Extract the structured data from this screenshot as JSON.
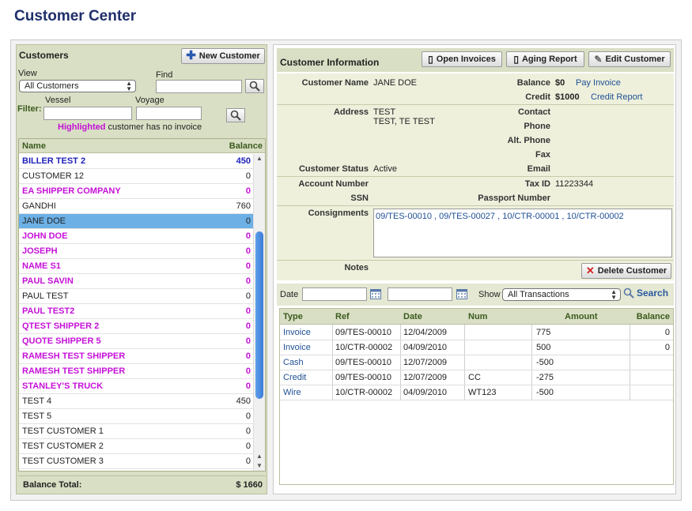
{
  "page": {
    "title": "Customer Center"
  },
  "customers_panel": {
    "title": "Customers",
    "new_button": "New Customer",
    "view_label": "View",
    "view_selected": "All Customers",
    "find_label": "Find",
    "filter_label": "Filter:",
    "vessel_label": "Vessel",
    "voyage_label": "Voyage",
    "legend_highlight": "Highlighted",
    "legend_rest": " customer has no invoice",
    "col_name": "Name",
    "col_balance": "Balance",
    "rows": [
      {
        "name": "BILLER TEST 2",
        "balance": "450",
        "style": "blue"
      },
      {
        "name": "CUSTOMER 12",
        "balance": "0",
        "style": ""
      },
      {
        "name": "EA SHIPPER COMPANY",
        "balance": "0",
        "style": "mag"
      },
      {
        "name": "GANDHI",
        "balance": "760",
        "style": ""
      },
      {
        "name": "JANE DOE",
        "balance": "0",
        "style": "sel"
      },
      {
        "name": "JOHN DOE",
        "balance": "0",
        "style": "mag"
      },
      {
        "name": "JOSEPH",
        "balance": "0",
        "style": "mag"
      },
      {
        "name": "NAME S1",
        "balance": "0",
        "style": "mag"
      },
      {
        "name": "PAUL SAVIN",
        "balance": "0",
        "style": "mag"
      },
      {
        "name": "PAUL TEST",
        "balance": "0",
        "style": ""
      },
      {
        "name": "PAUL TEST2",
        "balance": "0",
        "style": "mag"
      },
      {
        "name": "QTEST SHIPPER 2",
        "balance": "0",
        "style": "mag"
      },
      {
        "name": "QUOTE SHIPPER 5",
        "balance": "0",
        "style": "mag"
      },
      {
        "name": "RAMESH TEST SHIPPER",
        "balance": "0",
        "style": "mag"
      },
      {
        "name": "RAMESH TEST SHIPPER",
        "balance": "0",
        "style": "mag"
      },
      {
        "name": "STANLEY'S TRUCK",
        "balance": "0",
        "style": "mag"
      },
      {
        "name": "TEST 4",
        "balance": "450",
        "style": ""
      },
      {
        "name": "TEST 5",
        "balance": "0",
        "style": ""
      },
      {
        "name": "TEST CUSTOMER 1",
        "balance": "0",
        "style": ""
      },
      {
        "name": "TEST CUSTOMER 2",
        "balance": "0",
        "style": ""
      },
      {
        "name": "TEST CUSTOMER 3",
        "balance": "0",
        "style": ""
      }
    ],
    "total_label": "Balance Total:",
    "total_value": "$ 1660"
  },
  "info_panel": {
    "title": "Customer Information",
    "open_invoices": "Open Invoices",
    "aging_report": "Aging Report",
    "edit_customer": "Edit Customer",
    "customer_name_label": "Customer Name",
    "customer_name": "JANE DOE",
    "balance_label": "Balance",
    "balance_value": "$0",
    "pay_invoice": "Pay Invoice",
    "credit_label": "Credit",
    "credit_value": "$1000",
    "credit_report": "Credit Report",
    "address_label": "Address",
    "address_line1": "TEST",
    "address_line2": "TEST, TE TEST",
    "contact_label": "Contact",
    "phone_label": "Phone",
    "alt_phone_label": "Alt. Phone",
    "fax_label": "Fax",
    "email_label": "Email",
    "status_label": "Customer Status",
    "status_value": "Active",
    "account_label": "Account Number",
    "taxid_label": "Tax ID",
    "taxid_value": "11223344",
    "ssn_label": "SSN",
    "passport_label": "Passport Number",
    "consignments_label": "Consignments",
    "consignments": "09/TES-00010 , 09/TES-00027 , 10/CTR-00001 , 10/CTR-00002",
    "notes_label": "Notes",
    "delete_customer": "Delete Customer"
  },
  "filter": {
    "date_label": "Date",
    "show_label": "Show",
    "show_selected": "All Transactions",
    "search_label": "Search"
  },
  "transactions": {
    "columns": [
      "Type",
      "Ref",
      "Date",
      "Num",
      "Amount",
      "Balance"
    ],
    "rows": [
      {
        "type": "Invoice",
        "ref": "09/TES-00010",
        "date": "12/04/2009",
        "num": "",
        "amount": "775",
        "balance": "0"
      },
      {
        "type": "Invoice",
        "ref": "10/CTR-00002",
        "date": "04/09/2010",
        "num": "",
        "amount": "500",
        "balance": "0"
      },
      {
        "type": "Cash",
        "ref": "09/TES-00010",
        "date": "12/07/2009",
        "num": "",
        "amount": "-500",
        "balance": ""
      },
      {
        "type": "Credit",
        "ref": "09/TES-00010",
        "date": "12/07/2009",
        "num": "CC",
        "amount": "-275",
        "balance": ""
      },
      {
        "type": "Wire",
        "ref": "10/CTR-00002",
        "date": "04/09/2010",
        "num": "WT123",
        "amount": "-500",
        "balance": ""
      }
    ]
  },
  "colors": {
    "accent_blue": "#1f2f6b",
    "no_invoice_magenta": "#c510d8",
    "selected_row": "#6cb0e6",
    "panel_header": "#d9dfc4"
  }
}
